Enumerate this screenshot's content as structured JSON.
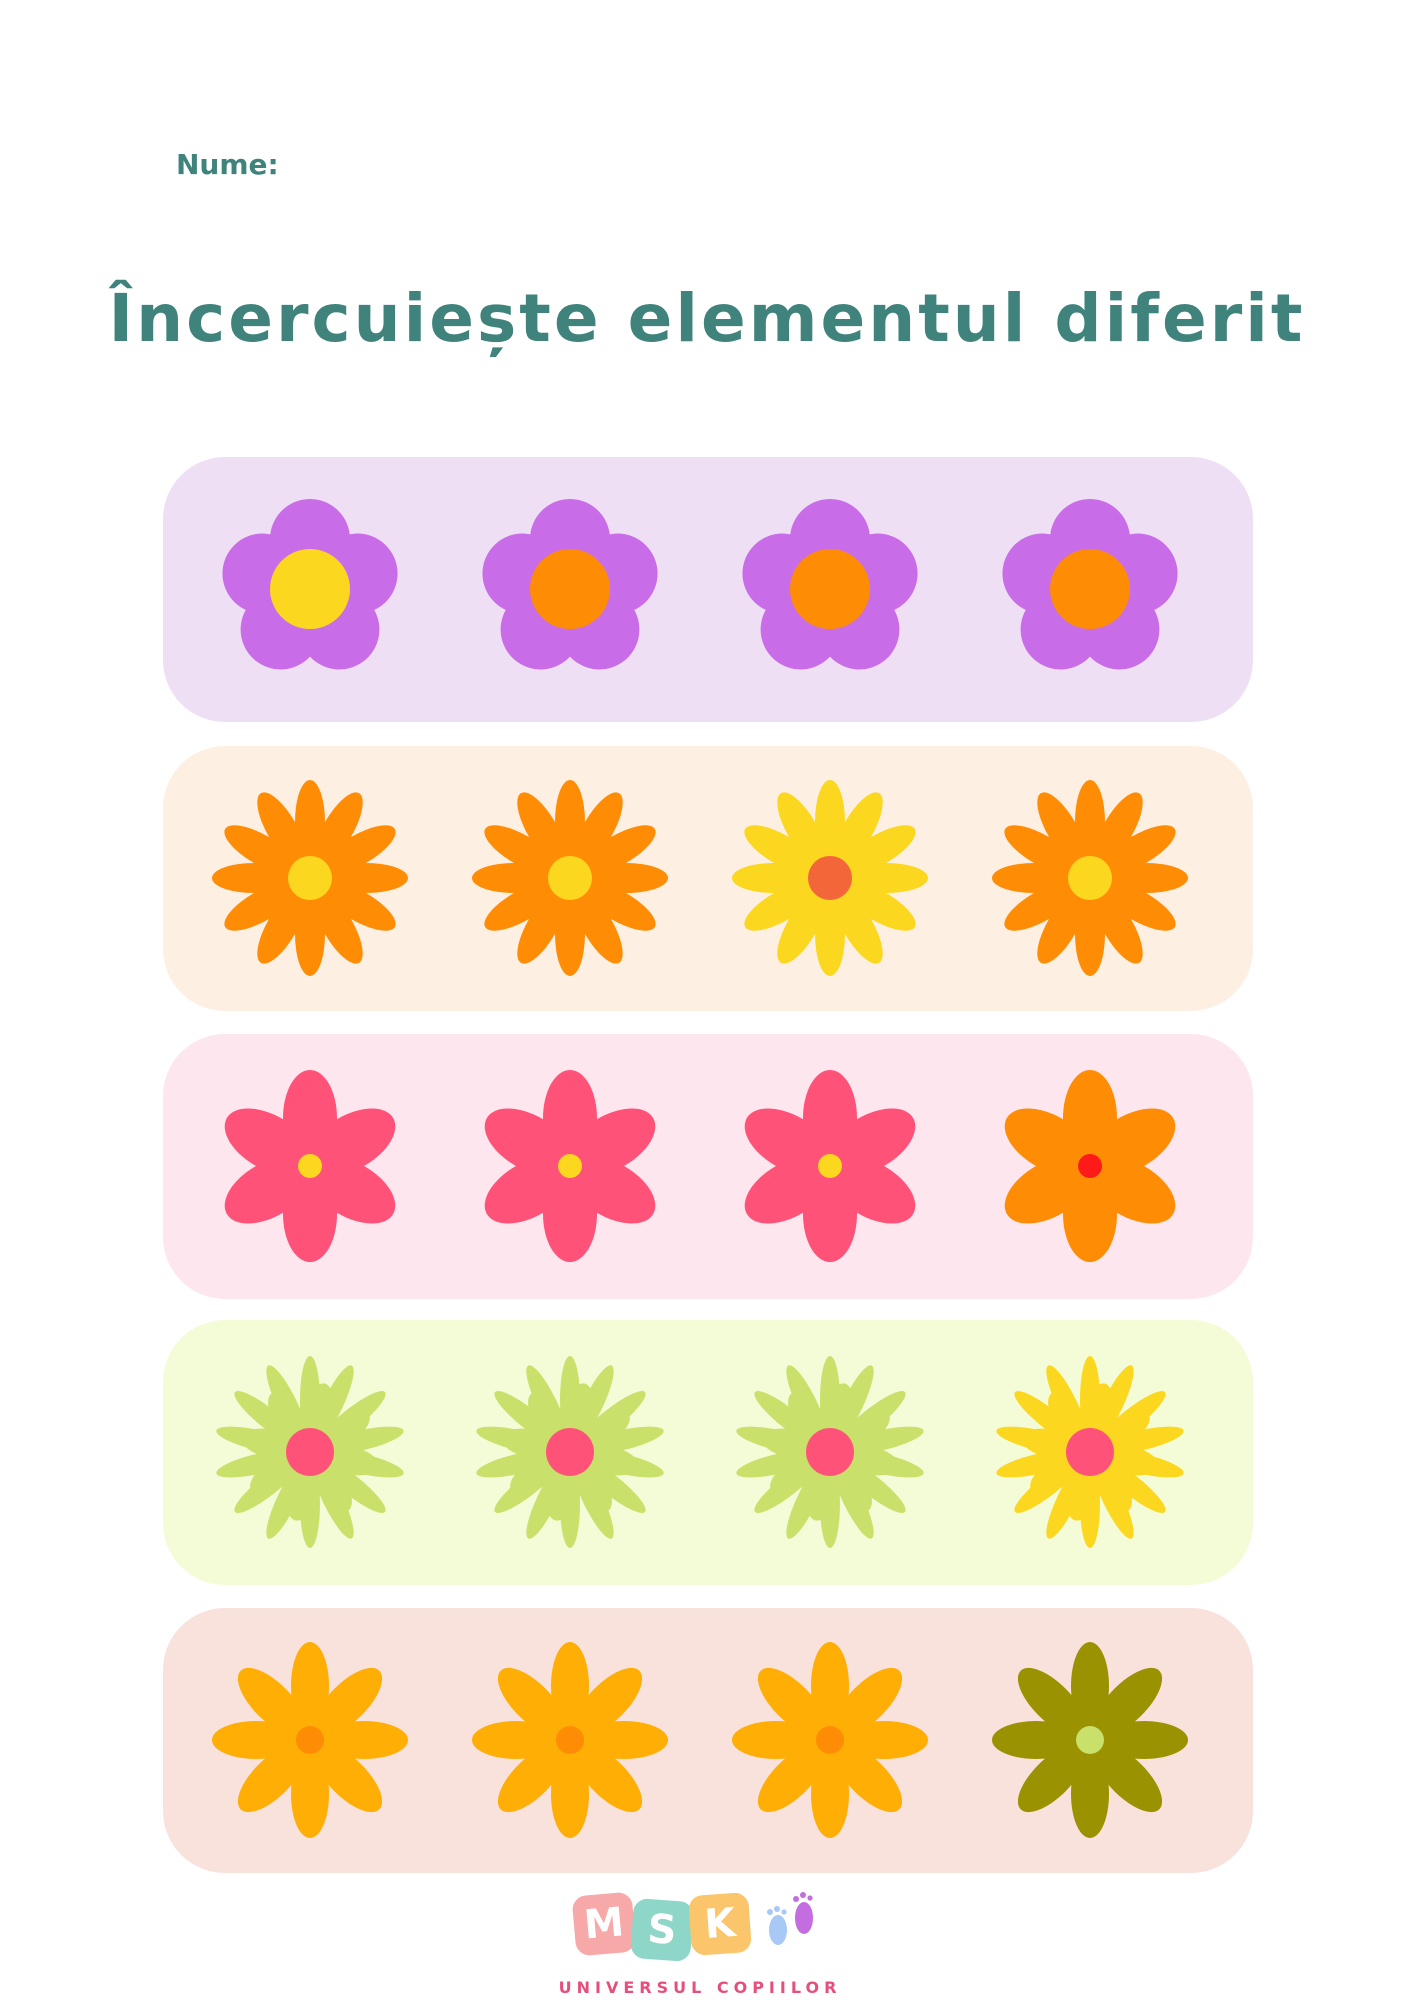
{
  "header": {
    "name_label": "Nume:",
    "title": "Încercuiește elementul diferit"
  },
  "rows": [
    {
      "background": "#efdff5",
      "flower_type": "round-petal-flower",
      "flowers": [
        {
          "petal": "#c96ce8",
          "center": "#fcd71f"
        },
        {
          "petal": "#c96ce8",
          "center": "#ff8c05"
        },
        {
          "petal": "#c96ce8",
          "center": "#ff8c05"
        },
        {
          "petal": "#c96ce8",
          "center": "#ff8c05"
        }
      ]
    },
    {
      "background": "#fdf0e3",
      "flower_type": "daisy-flower",
      "flowers": [
        {
          "petal": "#ff8c05",
          "center": "#fcd71f"
        },
        {
          "petal": "#ff8c05",
          "center": "#fcd71f"
        },
        {
          "petal": "#fcd71f",
          "center": "#f2663a"
        },
        {
          "petal": "#ff8c05",
          "center": "#fcd71f"
        }
      ]
    },
    {
      "background": "#fde6ed",
      "flower_type": "six-petal-flower",
      "flowers": [
        {
          "petal": "#ff5279",
          "center": "#fcd71f"
        },
        {
          "petal": "#ff5279",
          "center": "#fcd71f"
        },
        {
          "petal": "#ff5279",
          "center": "#fcd71f"
        },
        {
          "petal": "#ff8c05",
          "center": "#ff1a1a"
        }
      ]
    },
    {
      "background": "#f4fbd7",
      "flower_type": "spiky-flower",
      "flowers": [
        {
          "petal": "#c9e06a",
          "center": "#ff5279"
        },
        {
          "petal": "#c9e06a",
          "center": "#ff5279"
        },
        {
          "petal": "#c9e06a",
          "center": "#ff5279"
        },
        {
          "petal": "#fcd71f",
          "center": "#ff5279"
        }
      ]
    },
    {
      "background": "#f9e1dc",
      "flower_type": "eight-petal-flower",
      "flowers": [
        {
          "petal": "#ffae05",
          "center": "#ff8c05"
        },
        {
          "petal": "#ffae05",
          "center": "#ff8c05"
        },
        {
          "petal": "#ffae05",
          "center": "#ff8c05"
        },
        {
          "petal": "#9a9200",
          "center": "#c9e06a"
        }
      ]
    }
  ],
  "logo": {
    "letters": [
      {
        "char": "M",
        "color": "#f7a8a8"
      },
      {
        "char": "S",
        "color": "#8ed6c8"
      },
      {
        "char": "K",
        "color": "#fbc66b"
      }
    ],
    "footprint_colors": [
      "#a8c8f5",
      "#c36de0"
    ],
    "subtitle": "UNIVERSUL COPIILOR"
  }
}
